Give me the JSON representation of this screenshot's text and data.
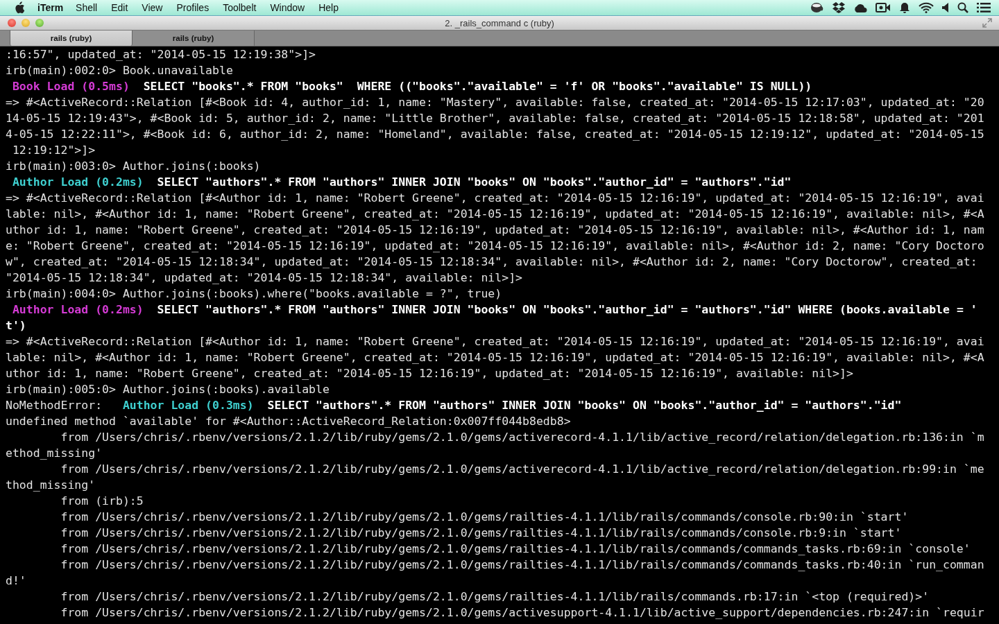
{
  "menu_bar": {
    "app_name": "iTerm",
    "menus": [
      "Shell",
      "Edit",
      "View",
      "Profiles",
      "Toolbelt",
      "Window",
      "Help"
    ]
  },
  "window": {
    "title": "2. _rails_command c (ruby)"
  },
  "tabs": [
    {
      "label": "rails (ruby)",
      "selected": true
    },
    {
      "label": "rails (ruby)",
      "selected": false
    }
  ],
  "terminal": {
    "lines": [
      [
        {
          "kind": "text",
          "text": ":16:57\", updated_at: \"2014-05-15 12:19:38\">]>"
        }
      ],
      [
        {
          "kind": "text",
          "text": "irb(main):002:0> Book.unavailable"
        }
      ],
      [
        {
          "kind": "log",
          "color": "#d53bd5",
          "text": " Book Load (0.5ms)"
        },
        {
          "kind": "sql",
          "text": "  SELECT \"books\".* FROM \"books\"  WHERE ((\"books\".\"available\" = 'f' OR \"books\".\"available\" IS NULL))"
        }
      ],
      [
        {
          "kind": "text",
          "text": "=> #<ActiveRecord::Relation [#<Book id: 4, author_id: 1, name: \"Mastery\", available: false, created_at: \"2014-05-15 12:17:03\", updated_at: \"20"
        }
      ],
      [
        {
          "kind": "text",
          "text": "14-05-15 12:19:43\">, #<Book id: 5, author_id: 2, name: \"Little Brother\", available: false, created_at: \"2014-05-15 12:18:58\", updated_at: \"201"
        }
      ],
      [
        {
          "kind": "text",
          "text": "4-05-15 12:22:11\">, #<Book id: 6, author_id: 2, name: \"Homeland\", available: false, created_at: \"2014-05-15 12:19:12\", updated_at: \"2014-05-15"
        }
      ],
      [
        {
          "kind": "text",
          "text": " 12:19:12\">]>"
        }
      ],
      [
        {
          "kind": "text",
          "text": "irb(main):003:0> Author.joins(:books)"
        }
      ],
      [
        {
          "kind": "log",
          "color": "#3fd0d0",
          "text": " Author Load (0.2ms)"
        },
        {
          "kind": "sql",
          "text": "  SELECT \"authors\".* FROM \"authors\" INNER JOIN \"books\" ON \"books\".\"author_id\" = \"authors\".\"id\""
        }
      ],
      [
        {
          "kind": "text",
          "text": "=> #<ActiveRecord::Relation [#<Author id: 1, name: \"Robert Greene\", created_at: \"2014-05-15 12:16:19\", updated_at: \"2014-05-15 12:16:19\", avai"
        }
      ],
      [
        {
          "kind": "text",
          "text": "lable: nil>, #<Author id: 1, name: \"Robert Greene\", created_at: \"2014-05-15 12:16:19\", updated_at: \"2014-05-15 12:16:19\", available: nil>, #<A"
        }
      ],
      [
        {
          "kind": "text",
          "text": "uthor id: 1, name: \"Robert Greene\", created_at: \"2014-05-15 12:16:19\", updated_at: \"2014-05-15 12:16:19\", available: nil>, #<Author id: 1, nam"
        }
      ],
      [
        {
          "kind": "text",
          "text": "e: \"Robert Greene\", created_at: \"2014-05-15 12:16:19\", updated_at: \"2014-05-15 12:16:19\", available: nil>, #<Author id: 2, name: \"Cory Doctoro"
        }
      ],
      [
        {
          "kind": "text",
          "text": "w\", created_at: \"2014-05-15 12:18:34\", updated_at: \"2014-05-15 12:18:34\", available: nil>, #<Author id: 2, name: \"Cory Doctorow\", created_at:"
        }
      ],
      [
        {
          "kind": "text",
          "text": "\"2014-05-15 12:18:34\", updated_at: \"2014-05-15 12:18:34\", available: nil>]>"
        }
      ],
      [
        {
          "kind": "text",
          "text": "irb(main):004:0> Author.joins(:books).where(\"books.available = ?\", true)"
        }
      ],
      [
        {
          "kind": "log",
          "color": "#d53bd5",
          "text": " Author Load (0.2ms)"
        },
        {
          "kind": "sql",
          "text": "  SELECT \"authors\".* FROM \"authors\" INNER JOIN \"books\" ON \"books\".\"author_id\" = \"authors\".\"id\" WHERE (books.available = '"
        }
      ],
      [
        {
          "kind": "sql",
          "text": "t')"
        }
      ],
      [
        {
          "kind": "text",
          "text": "=> #<ActiveRecord::Relation [#<Author id: 1, name: \"Robert Greene\", created_at: \"2014-05-15 12:16:19\", updated_at: \"2014-05-15 12:16:19\", avai"
        }
      ],
      [
        {
          "kind": "text",
          "text": "lable: nil>, #<Author id: 1, name: \"Robert Greene\", created_at: \"2014-05-15 12:16:19\", updated_at: \"2014-05-15 12:16:19\", available: nil>, #<A"
        }
      ],
      [
        {
          "kind": "text",
          "text": "uthor id: 1, name: \"Robert Greene\", created_at: \"2014-05-15 12:16:19\", updated_at: \"2014-05-15 12:16:19\", available: nil>]>"
        }
      ],
      [
        {
          "kind": "text",
          "text": "irb(main):005:0> Author.joins(:books).available"
        }
      ],
      [
        {
          "kind": "text",
          "text": "NoMethodError:"
        },
        {
          "kind": "log",
          "color": "#3fd0d0",
          "text": "   Author Load (0.3ms)"
        },
        {
          "kind": "sql",
          "text": "  SELECT \"authors\".* FROM \"authors\" INNER JOIN \"books\" ON \"books\".\"author_id\" = \"authors\".\"id\""
        }
      ],
      [
        {
          "kind": "text",
          "text": "undefined method `available' for #<Author::ActiveRecord_Relation:0x007ff044b8edb8>"
        }
      ],
      [
        {
          "kind": "text",
          "text": "        from /Users/chris/.rbenv/versions/2.1.2/lib/ruby/gems/2.1.0/gems/activerecord-4.1.1/lib/active_record/relation/delegation.rb:136:in `m"
        }
      ],
      [
        {
          "kind": "text",
          "text": "ethod_missing'"
        }
      ],
      [
        {
          "kind": "text",
          "text": "        from /Users/chris/.rbenv/versions/2.1.2/lib/ruby/gems/2.1.0/gems/activerecord-4.1.1/lib/active_record/relation/delegation.rb:99:in `me"
        }
      ],
      [
        {
          "kind": "text",
          "text": "thod_missing'"
        }
      ],
      [
        {
          "kind": "text",
          "text": "        from (irb):5"
        }
      ],
      [
        {
          "kind": "text",
          "text": "        from /Users/chris/.rbenv/versions/2.1.2/lib/ruby/gems/2.1.0/gems/railties-4.1.1/lib/rails/commands/console.rb:90:in `start'"
        }
      ],
      [
        {
          "kind": "text",
          "text": "        from /Users/chris/.rbenv/versions/2.1.2/lib/ruby/gems/2.1.0/gems/railties-4.1.1/lib/rails/commands/console.rb:9:in `start'"
        }
      ],
      [
        {
          "kind": "text",
          "text": "        from /Users/chris/.rbenv/versions/2.1.2/lib/ruby/gems/2.1.0/gems/railties-4.1.1/lib/rails/commands/commands_tasks.rb:69:in `console'"
        }
      ],
      [
        {
          "kind": "text",
          "text": "        from /Users/chris/.rbenv/versions/2.1.2/lib/ruby/gems/2.1.0/gems/railties-4.1.1/lib/rails/commands/commands_tasks.rb:40:in `run_comman"
        }
      ],
      [
        {
          "kind": "text",
          "text": "d!'"
        }
      ],
      [
        {
          "kind": "text",
          "text": "        from /Users/chris/.rbenv/versions/2.1.2/lib/ruby/gems/2.1.0/gems/railties-4.1.1/lib/rails/commands.rb:17:in `<top (required)>'"
        }
      ],
      [
        {
          "kind": "text",
          "text": "        from /Users/chris/.rbenv/versions/2.1.2/lib/ruby/gems/2.1.0/gems/activesupport-4.1.1/lib/active_support/dependencies.rb:247:in `requir"
        }
      ]
    ]
  }
}
